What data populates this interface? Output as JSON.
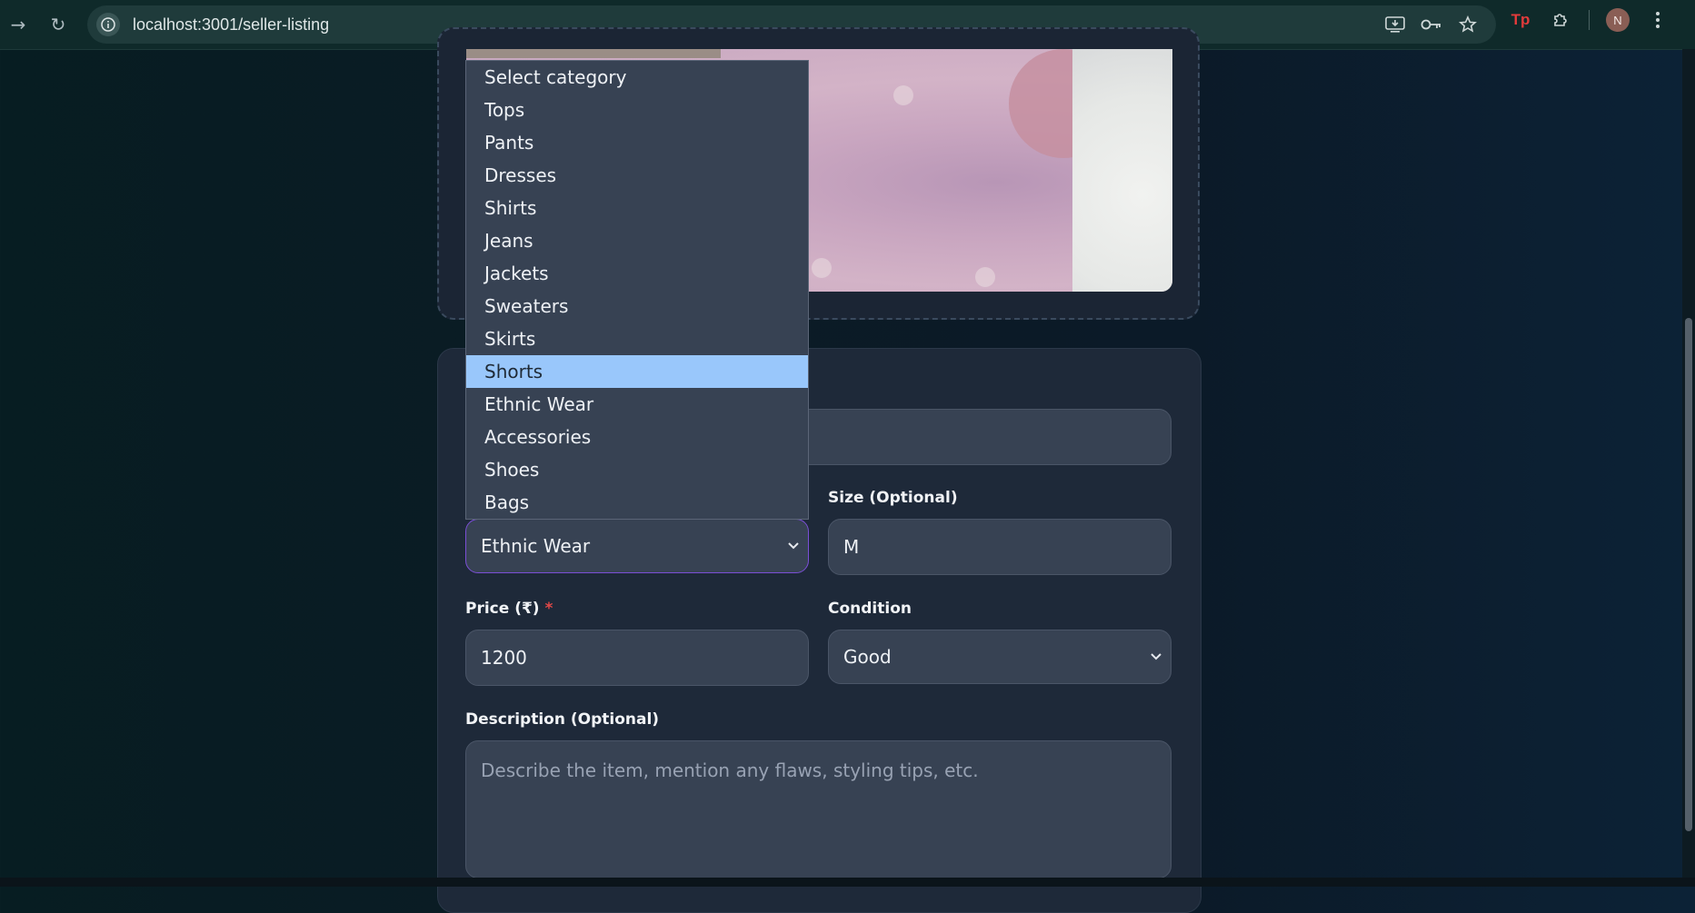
{
  "browser": {
    "url": "localhost:3001/seller-listing",
    "avatar_initial": "N",
    "ext_label": "Tp"
  },
  "form": {
    "category": {
      "selected": "Ethnic Wear",
      "options": [
        "Select category",
        "Tops",
        "Pants",
        "Dresses",
        "Shirts",
        "Jeans",
        "Jackets",
        "Sweaters",
        "Skirts",
        "Shorts",
        "Ethnic Wear",
        "Accessories",
        "Shoes",
        "Bags"
      ],
      "highlighted": "Shorts"
    },
    "size": {
      "label": "Size (Optional)",
      "value": "M"
    },
    "price": {
      "label": "Price (₹)",
      "required_mark": "*",
      "value": "1200"
    },
    "condition": {
      "label": "Condition",
      "value": "Good"
    },
    "description": {
      "label": "Description (Optional)",
      "placeholder": "Describe the item, mention any flaws, styling tips, etc."
    }
  },
  "colors": {
    "accent_focus": "#7b4fd6",
    "highlight": "#99c7fb",
    "required": "#e04848"
  }
}
